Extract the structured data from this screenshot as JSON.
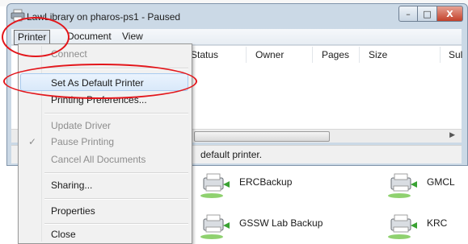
{
  "window": {
    "title": "LawLibrary on pharos-ps1 - Paused",
    "controls": {
      "minimize": "–",
      "maximize": "□",
      "close": "X"
    }
  },
  "menubar": {
    "items": [
      "Printer",
      "Document",
      "View"
    ]
  },
  "columns": [
    "Status",
    "Owner",
    "Pages",
    "Size",
    "Sul"
  ],
  "status_text": "default printer.",
  "dropdown": {
    "items": [
      {
        "label": "Connect",
        "state": "disabled"
      },
      {
        "label": "Set As Default Printer",
        "state": "highlighted"
      },
      {
        "label": "Printing Preferences...",
        "state": "normal"
      },
      {
        "label": "Update Driver",
        "state": "disabled"
      },
      {
        "label": "Pause Printing",
        "state": "disabled",
        "checked": true,
        "check_glyph": "✓"
      },
      {
        "label": "Cancel All Documents",
        "state": "disabled"
      },
      {
        "label": "Sharing...",
        "state": "normal"
      },
      {
        "label": "Properties",
        "state": "normal"
      },
      {
        "label": "Close",
        "state": "normal"
      }
    ]
  },
  "printers": [
    {
      "name": "ERCBackup",
      "icon": "network-printer-icon"
    },
    {
      "name": "GMCL",
      "icon": "network-printer-icon"
    },
    {
      "name": "GSSW Lab Backup",
      "icon": "network-printer-icon"
    },
    {
      "name": "KRC",
      "icon": "network-printer-icon"
    }
  ],
  "colors": {
    "annotation_red": "#e3161b",
    "menu_highlight": "#d9e9fa",
    "window_frame": "#cbd9e6"
  }
}
